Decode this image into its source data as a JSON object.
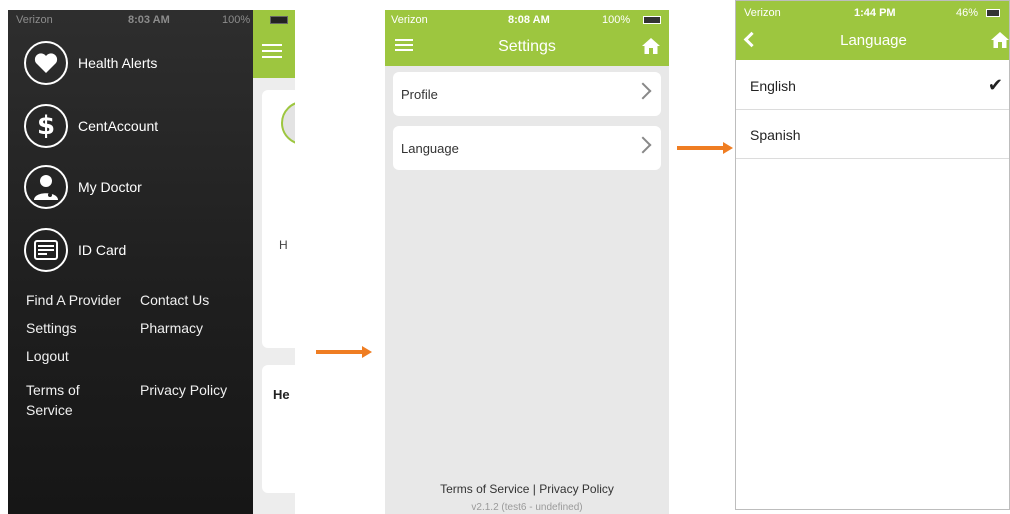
{
  "screen1": {
    "status": {
      "carrier": "Verizon",
      "time": "8:03 AM",
      "battery": "100%"
    },
    "menu_items": [
      {
        "label": "Health Alerts",
        "icon": "heart-icon"
      },
      {
        "label": "CentAccount",
        "icon": "dollar-icon"
      },
      {
        "label": "My Doctor",
        "icon": "doctor-icon"
      },
      {
        "label": "ID Card",
        "icon": "id-card-icon"
      }
    ],
    "links": {
      "find_provider": "Find A Provider",
      "contact_us": "Contact Us",
      "settings": "Settings",
      "pharmacy": "Pharmacy",
      "logout": "Logout",
      "terms": "Terms of Service",
      "privacy": "Privacy Policy"
    },
    "peek": {
      "letter": "H",
      "heading": "He"
    },
    "colors": {
      "accent": "#9dc63f",
      "drawer": "#222222"
    }
  },
  "screen2": {
    "status": {
      "carrier": "Verizon",
      "time": "8:08 AM",
      "battery": "100%"
    },
    "title": "Settings",
    "rows": [
      "Profile",
      "Language"
    ],
    "footer": {
      "terms": "Terms of Service",
      "separator": "|",
      "privacy": "Privacy Policy"
    },
    "version": "v2.1.2 (test6 - undefined)"
  },
  "screen3": {
    "status": {
      "carrier": "Verizon",
      "time": "1:44 PM",
      "battery": "46%"
    },
    "title": "Language",
    "options": [
      "English",
      "Spanish"
    ],
    "selected": "English"
  },
  "arrow_color": "#ef7d22"
}
